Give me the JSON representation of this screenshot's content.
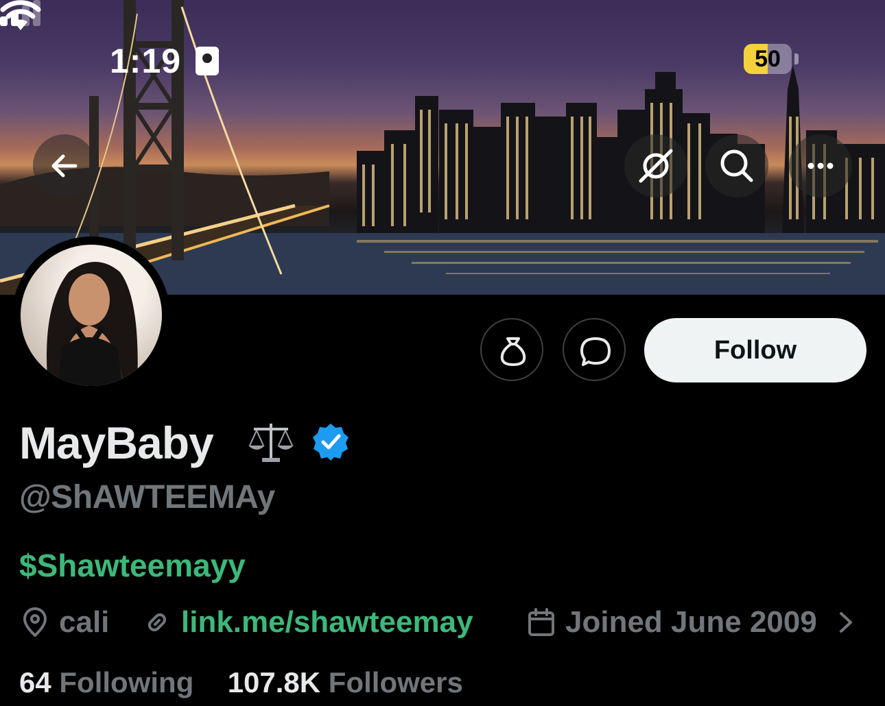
{
  "status_bar": {
    "time": "1:19",
    "battery": "50"
  },
  "colors": {
    "background": "#000000",
    "text_primary": "#e7e9ea",
    "text_secondary": "#71767b",
    "accent_green": "#3db87a",
    "verified_blue": "#1d9bf0",
    "follow_button_bg": "#eff3f4"
  },
  "header": {
    "back_icon": "arrow-left-icon",
    "grok_icon": "grok-slash-icon",
    "search_icon": "search-icon",
    "more_icon": "more-dots-icon"
  },
  "actions": {
    "tip_icon": "money-bag-icon",
    "message_icon": "message-bubble-icon",
    "follow_label": "Follow"
  },
  "profile": {
    "display_name": "MayBaby",
    "name_emoji_icon": "balance-scale-icon",
    "verified_icon": "verified-badge-icon",
    "handle": "@ShAWTEEMAy",
    "bio": "$Shawteemayy",
    "location": "cali",
    "link": "link.me/shawteemay",
    "joined": "Joined June 2009"
  },
  "stats": {
    "following_count": "64",
    "following_label": "Following",
    "followers_count": "107.8K",
    "followers_label": "Followers"
  }
}
